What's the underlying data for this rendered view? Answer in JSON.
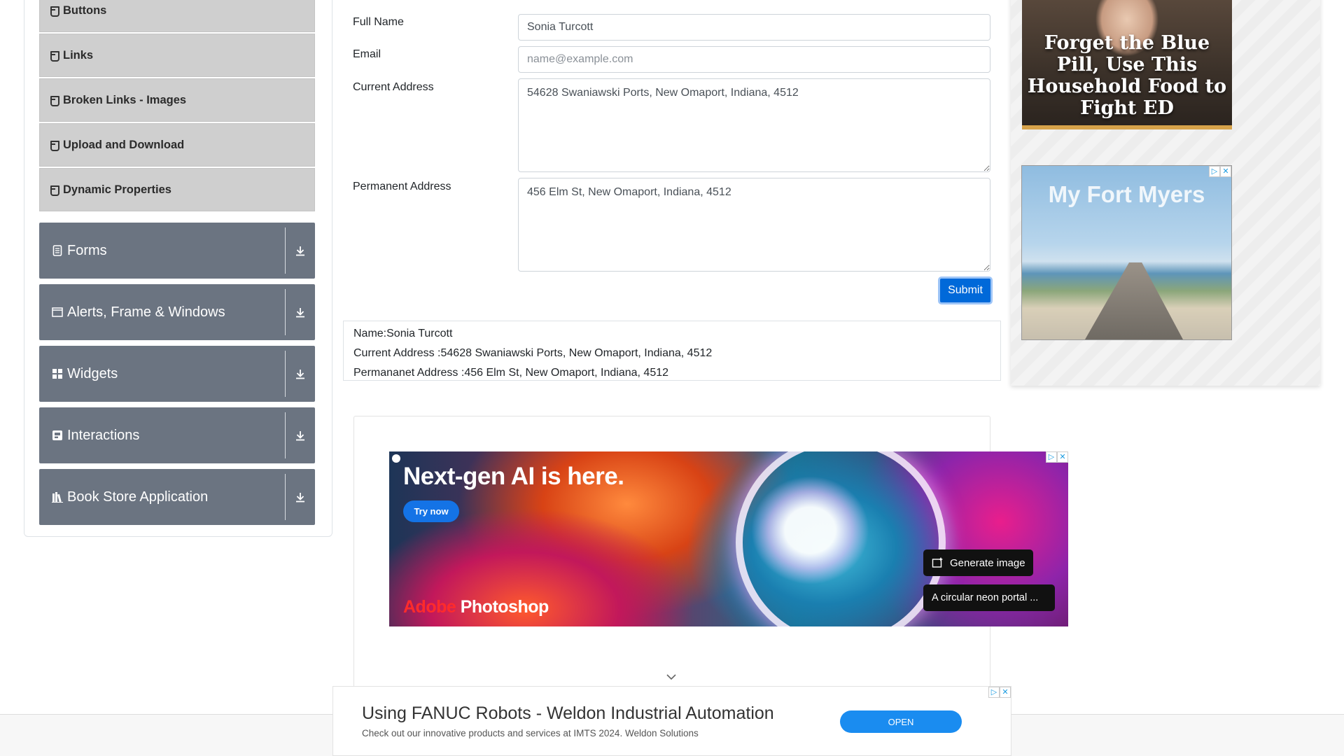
{
  "sidebar": {
    "elements_items": [
      {
        "label": "Buttons"
      },
      {
        "label": "Links"
      },
      {
        "label": "Broken Links - Images"
      },
      {
        "label": "Upload and Download"
      },
      {
        "label": "Dynamic Properties"
      }
    ],
    "groups": [
      {
        "label": "Forms",
        "icon": "form-icon"
      },
      {
        "label": "Alerts, Frame & Windows",
        "icon": "window-icon"
      },
      {
        "label": "Widgets",
        "icon": "widgets-icon"
      },
      {
        "label": "Interactions",
        "icon": "interactions-icon"
      },
      {
        "label": "Book Store Application",
        "icon": "bookstore-icon"
      }
    ]
  },
  "form": {
    "full_name": {
      "label": "Full Name",
      "value": "Sonia Turcott"
    },
    "email": {
      "label": "Email",
      "value": "",
      "placeholder": "name@example.com"
    },
    "current_address": {
      "label": "Current Address",
      "value": "54628 Swaniawski Ports, New Omaport, Indiana, 4512"
    },
    "permanent_address": {
      "label": "Permanent Address",
      "value": "456 Elm St, New Omaport, Indiana, 4512"
    },
    "submit_label": "Submit"
  },
  "output": {
    "name": "Name:Sonia Turcott",
    "current_address": "Current Address :54628 Swaniawski Ports, New Omaport, Indiana, 4512",
    "permanent_address": "Permananet Address :456 Elm St, New Omaport, Indiana, 4512"
  },
  "ads": {
    "adobe": {
      "headline": "Next-gen AI is here.",
      "cta": "Try now",
      "brand_prefix": "Adobe",
      "brand_suffix": " Photoshop",
      "generate_label": "Generate image",
      "prompt_text": "A circular neon portal ..."
    },
    "food": {
      "headline": "Forget the Blue Pill, Use This Household Food to Fight ED"
    },
    "fortmyers": {
      "title": "My Fort Myers"
    },
    "fanuc": {
      "title": "Using FANUC Robots - Weldon Industrial Automation",
      "subtitle": "Check out our innovative products and services at IMTS 2024. Weldon Solutions",
      "cta": "OPEN"
    }
  },
  "colors": {
    "group_bg": "#6b7481",
    "menu_item_bg": "#cfcfcf",
    "submit_bg": "#0069d9"
  }
}
